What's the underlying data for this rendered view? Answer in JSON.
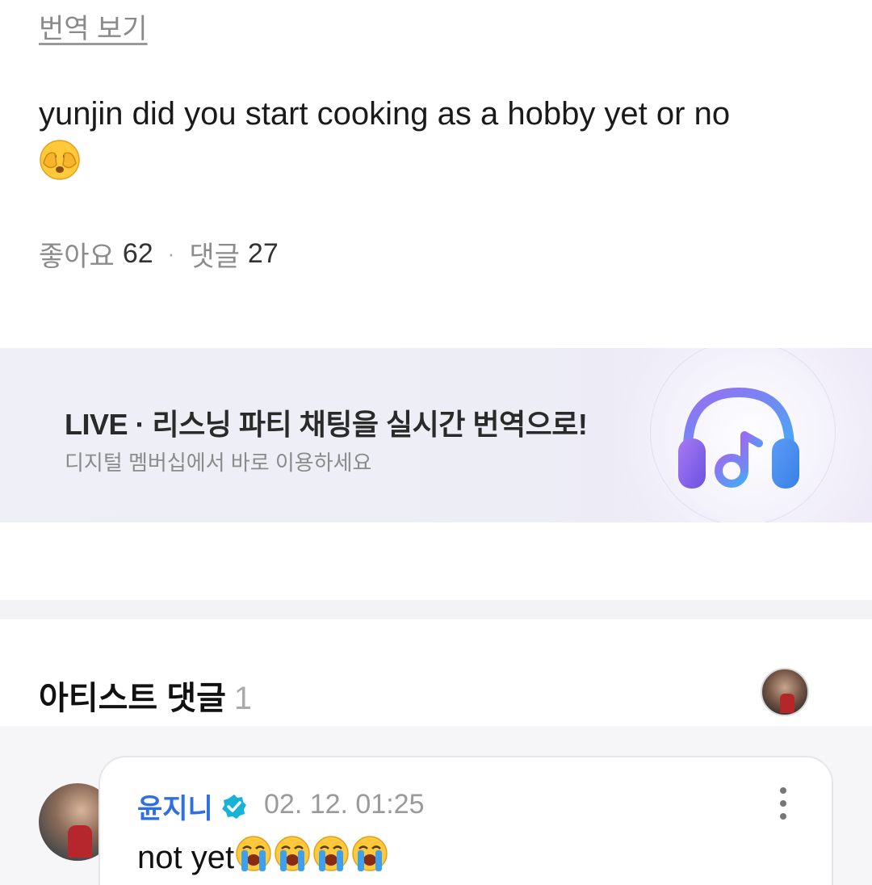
{
  "post": {
    "translate_label": "번역 보기",
    "text": "yunjin did you start cooking as a hobby yet or no",
    "emoji_icon": "face-with-hand-over-eyes-icon",
    "likes_label": "좋아요",
    "likes_count": "62",
    "separator": "·",
    "comments_label": "댓글",
    "comments_count": "27"
  },
  "banner": {
    "title": "LIVE · 리스닝 파티 채팅을 실시간 번역으로!",
    "subtitle": "디지털 멤버십에서 바로 이용하세요",
    "icon": "headphones-music-icon",
    "accent_colors": [
      "#7b5cf0",
      "#4aa6f5"
    ]
  },
  "artist_comments": {
    "title": "아티스트 댓글",
    "count": "1"
  },
  "comment": {
    "author": "윤지니",
    "verified_color": "#17b3d6",
    "timestamp": "02. 12. 01:25",
    "text": "not yet",
    "emoji_icon": "loudly-crying-face-icon",
    "emoji_count": 4,
    "author_color": "#2f6fe0"
  }
}
